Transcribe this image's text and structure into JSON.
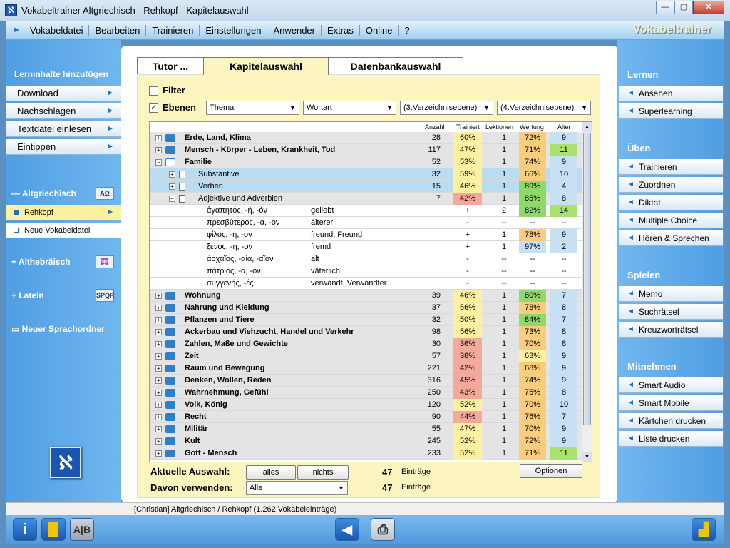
{
  "window": {
    "title": "Vokabeltrainer Altgriechisch - Rehkopf - Kapitelauswahl",
    "app_icon": "ℵ"
  },
  "menu": {
    "items": [
      "Vokabeldatei",
      "Bearbeiten",
      "Trainieren",
      "Einstellungen",
      "Anwender",
      "Extras",
      "Online",
      "?"
    ],
    "brand": "Vokabeltrainer"
  },
  "left": {
    "section_title": "Lerninhalte hinzufügen",
    "buttons": [
      "Download",
      "Nachschlagen",
      "Textdatei einlesen",
      "Eintippen"
    ],
    "languages": [
      {
        "name": "Altgriechisch",
        "badge": "ΑΩ"
      },
      {
        "name": "Althebräisch",
        "badge": "🕎"
      },
      {
        "name": "Latein",
        "badge": "SPQR"
      }
    ],
    "subs": [
      "Rehkopf",
      "Neue Vokabeldatei"
    ],
    "folder": "Neuer Sprachordner"
  },
  "right": {
    "sections": [
      {
        "title": "Lernen",
        "items": [
          "Ansehen",
          "Superlearning"
        ]
      },
      {
        "title": "Üben",
        "items": [
          "Trainieren",
          "Zuordnen",
          "Diktat",
          "Multiple Choice",
          "Hören & Sprechen"
        ]
      },
      {
        "title": "Spielen",
        "items": [
          "Memo",
          "Suchrätsel",
          "Kreuzworträtsel"
        ]
      },
      {
        "title": "Mitnehmen",
        "items": [
          "Smart Audio",
          "Smart Mobile",
          "Kärtchen drucken",
          "Liste drucken"
        ]
      }
    ]
  },
  "tabs": [
    "Tutor ...",
    "Kapitelauswahl",
    "Datenbankauswahl"
  ],
  "filter": {
    "label": "Filter",
    "checked": false
  },
  "ebenen": {
    "label": "Ebenen",
    "checked": true
  },
  "dropdowns": [
    "Thema",
    "Wortart",
    "(3.Verzeichnisebene)",
    "(4.Verzeichnisebene)"
  ],
  "columns": {
    "anzahl": "Anzahl",
    "trainiert": "Trainiert",
    "lektionen": "Lektionen",
    "wertung": "Wertung",
    "alter": "Alter"
  },
  "rows": [
    {
      "lvl": 0,
      "exp": "+",
      "icon": "book",
      "name": "Erde, Land, Klima",
      "n": "28",
      "tr": "60%",
      "lk": "1",
      "we": "72%",
      "al": "9",
      "trc": "#fdf0a0",
      "wec": "#f9cd7b",
      "alc": "#c7e0f3",
      "bold": true
    },
    {
      "lvl": 0,
      "exp": "+",
      "icon": "book",
      "name": "Mensch - Körper - Leben, Krankheit, Tod",
      "n": "117",
      "tr": "47%",
      "lk": "1",
      "we": "71%",
      "al": "11",
      "trc": "#fdf0a0",
      "wec": "#f9cd7b",
      "alc": "#a9e06e",
      "bold": true
    },
    {
      "lvl": 0,
      "exp": "−",
      "icon": "open",
      "name": "Familie",
      "n": "52",
      "tr": "53%",
      "lk": "1",
      "we": "74%",
      "al": "9",
      "trc": "#fdf0a0",
      "wec": "#f9cd7b",
      "alc": "#c7e0f3",
      "bold": true
    },
    {
      "lvl": 1,
      "exp": "+",
      "icon": "doc",
      "name": "Substantive",
      "n": "32",
      "tr": "59%",
      "lk": "1",
      "we": "66%",
      "al": "10",
      "trc": "#fdf0a0",
      "wec": "#f9cd7b",
      "alc": "#c7e0f3",
      "blue": true
    },
    {
      "lvl": 1,
      "exp": "+",
      "icon": "doc",
      "name": "Verben",
      "n": "15",
      "tr": "46%",
      "lk": "1",
      "we": "89%",
      "al": "4",
      "trc": "#fdf0a0",
      "wec": "#8fd96a",
      "alc": "#c7e0f3",
      "blue": true
    },
    {
      "lvl": 1,
      "exp": "−",
      "icon": "doc",
      "name": "Adjektive und Adverbien",
      "n": "7",
      "tr": "42%",
      "lk": "1",
      "we": "85%",
      "al": "8",
      "trc": "#f4a99a",
      "wec": "#8fd96a",
      "alc": "#c7e0f3"
    },
    {
      "word": true,
      "gr": "ἀγαπητός, -ή, -όν",
      "de": "geliebt",
      "tr": "+",
      "lk": "2",
      "we": "82%",
      "al": "14",
      "wec": "#8fd96a",
      "alc": "#a9e06e"
    },
    {
      "word": true,
      "gr": "πρεσβύτερος, -α, -ον",
      "de": "älterer",
      "tr": "-",
      "lk": "--",
      "we": "--",
      "al": "--"
    },
    {
      "word": true,
      "gr": "φίλος, -η, -ον",
      "de": "freund, Freund",
      "tr": "+",
      "lk": "1",
      "we": "78%",
      "al": "9",
      "wec": "#f9cd7b",
      "alc": "#c7e0f3"
    },
    {
      "word": true,
      "gr": "ξένος, -η, -ον",
      "de": "fremd",
      "tr": "+",
      "lk": "1",
      "we": "97%",
      "al": "2",
      "wec": "#c7e0f3",
      "alc": "#c7e0f3"
    },
    {
      "word": true,
      "gr": "ἀρχαῖος, -αία, -αῖον",
      "de": "alt",
      "tr": "-",
      "lk": "--",
      "we": "--",
      "al": "--"
    },
    {
      "word": true,
      "gr": "πάτριος, -α, -ον",
      "de": "väterlich",
      "tr": "-",
      "lk": "--",
      "we": "--",
      "al": "--"
    },
    {
      "word": true,
      "gr": "συγγενής, -ές",
      "de": "verwandt, Verwandter",
      "tr": "-",
      "lk": "--",
      "we": "--",
      "al": "--"
    },
    {
      "lvl": 0,
      "exp": "+",
      "icon": "book",
      "name": "Wohnung",
      "n": "39",
      "tr": "46%",
      "lk": "1",
      "we": "80%",
      "al": "7",
      "trc": "#fdf0a0",
      "wec": "#8fd96a",
      "alc": "#c7e0f3",
      "bold": true
    },
    {
      "lvl": 0,
      "exp": "+",
      "icon": "book",
      "name": "Nahrung und Kleidung",
      "n": "37",
      "tr": "56%",
      "lk": "1",
      "we": "78%",
      "al": "8",
      "trc": "#fdf0a0",
      "wec": "#f9cd7b",
      "alc": "#c7e0f3",
      "bold": true
    },
    {
      "lvl": 0,
      "exp": "+",
      "icon": "book",
      "name": "Pflanzen und Tiere",
      "n": "32",
      "tr": "50%",
      "lk": "1",
      "we": "84%",
      "al": "7",
      "trc": "#fdf0a0",
      "wec": "#8fd96a",
      "alc": "#c7e0f3",
      "bold": true
    },
    {
      "lvl": 0,
      "exp": "+",
      "icon": "book",
      "name": "Ackerbau und Viehzucht, Handel und Verkehr",
      "n": "98",
      "tr": "56%",
      "lk": "1",
      "we": "73%",
      "al": "8",
      "trc": "#fdf0a0",
      "wec": "#f9cd7b",
      "alc": "#c7e0f3",
      "bold": true
    },
    {
      "lvl": 0,
      "exp": "+",
      "icon": "book",
      "name": "Zahlen, Maße und Gewichte",
      "n": "30",
      "tr": "36%",
      "lk": "1",
      "we": "70%",
      "al": "8",
      "trc": "#f4a99a",
      "wec": "#f9cd7b",
      "alc": "#c7e0f3",
      "bold": true
    },
    {
      "lvl": 0,
      "exp": "+",
      "icon": "book",
      "name": "Zeit",
      "n": "57",
      "tr": "38%",
      "lk": "1",
      "we": "63%",
      "al": "9",
      "trc": "#f4a99a",
      "wec": "#fdf0a0",
      "alc": "#c7e0f3",
      "bold": true
    },
    {
      "lvl": 0,
      "exp": "+",
      "icon": "book",
      "name": "Raum und Bewegung",
      "n": "221",
      "tr": "42%",
      "lk": "1",
      "we": "68%",
      "al": "9",
      "trc": "#f4a99a",
      "wec": "#f9cd7b",
      "alc": "#c7e0f3",
      "bold": true
    },
    {
      "lvl": 0,
      "exp": "+",
      "icon": "book",
      "name": "Denken, Wollen, Reden",
      "n": "316",
      "tr": "45%",
      "lk": "1",
      "we": "74%",
      "al": "9",
      "trc": "#f4a99a",
      "wec": "#f9cd7b",
      "alc": "#c7e0f3",
      "bold": true
    },
    {
      "lvl": 0,
      "exp": "+",
      "icon": "book",
      "name": "Wahrnehmung, Gefühl",
      "n": "250",
      "tr": "43%",
      "lk": "1",
      "we": "75%",
      "al": "8",
      "trc": "#f4a99a",
      "wec": "#f9cd7b",
      "alc": "#c7e0f3",
      "bold": true
    },
    {
      "lvl": 0,
      "exp": "+",
      "icon": "book",
      "name": "Volk, König",
      "n": "120",
      "tr": "52%",
      "lk": "1",
      "we": "70%",
      "al": "10",
      "trc": "#fdf0a0",
      "wec": "#f9cd7b",
      "alc": "#c7e0f3",
      "bold": true
    },
    {
      "lvl": 0,
      "exp": "+",
      "icon": "book",
      "name": "Recht",
      "n": "90",
      "tr": "44%",
      "lk": "1",
      "we": "76%",
      "al": "7",
      "trc": "#f4a99a",
      "wec": "#f9cd7b",
      "alc": "#c7e0f3",
      "bold": true
    },
    {
      "lvl": 0,
      "exp": "+",
      "icon": "book",
      "name": "Militär",
      "n": "55",
      "tr": "47%",
      "lk": "1",
      "we": "70%",
      "al": "9",
      "trc": "#fdf0a0",
      "wec": "#f9cd7b",
      "alc": "#c7e0f3",
      "bold": true
    },
    {
      "lvl": 0,
      "exp": "+",
      "icon": "book",
      "name": "Kult",
      "n": "245",
      "tr": "52%",
      "lk": "1",
      "we": "72%",
      "al": "9",
      "trc": "#fdf0a0",
      "wec": "#f9cd7b",
      "alc": "#c7e0f3",
      "bold": true
    },
    {
      "lvl": 0,
      "exp": "+",
      "icon": "book",
      "name": "Gott - Mensch",
      "n": "233",
      "tr": "52%",
      "lk": "1",
      "we": "71%",
      "al": "11",
      "trc": "#fdf0a0",
      "wec": "#f9cd7b",
      "alc": "#a9e06e",
      "bold": true
    }
  ],
  "bottom": {
    "aktuelle_label": "Aktuelle Auswahl:",
    "alles": "alles",
    "nichts": "nichts",
    "count1": "47",
    "eintraege": "Einträge",
    "optionen": "Optionen",
    "davon_label": "Davon verwenden:",
    "davon_value": "Alle",
    "count2": "47"
  },
  "status": "[Christian]  Altgriechisch / Rehkopf  (1.262 Vokabeleinträge)"
}
